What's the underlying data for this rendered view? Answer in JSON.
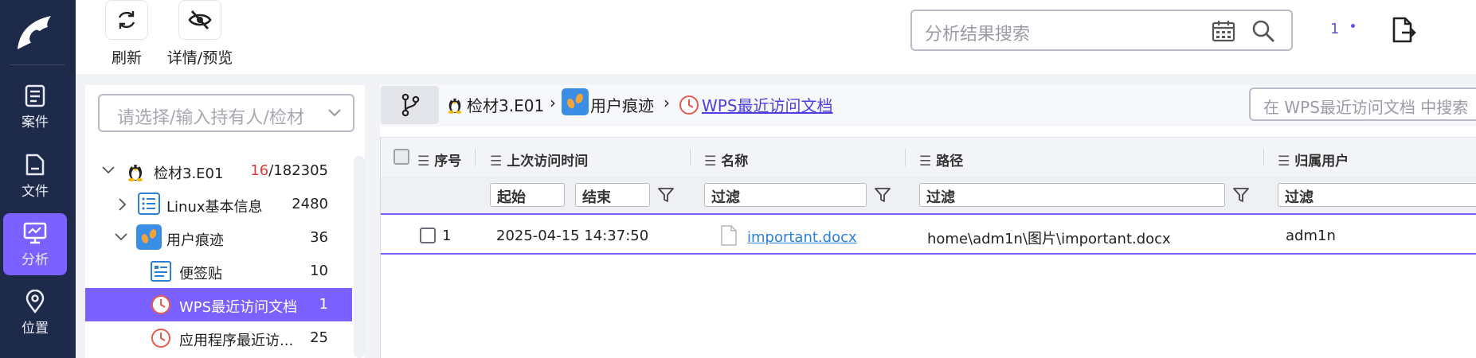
{
  "sidebar": {
    "items": [
      {
        "label": "案件",
        "icon": "clipboard-icon",
        "active": false
      },
      {
        "label": "文件",
        "icon": "file-icon",
        "active": false
      },
      {
        "label": "分析",
        "icon": "analysis-screen-icon",
        "active": true
      },
      {
        "label": "位置",
        "icon": "location-pin-icon",
        "active": false
      }
    ],
    "accent": "#7b61ff",
    "background": "#1e2a4a"
  },
  "toolbar": {
    "refresh_label": "刷新",
    "details_label": "详情/预览"
  },
  "top_search": {
    "placeholder": "分析结果搜索"
  },
  "notifications": {
    "count": "1"
  },
  "tree": {
    "holder_placeholder": "请选择/输入持有人/检材",
    "nodes": [
      {
        "label": "检材3.E01",
        "count_highlight": "16",
        "count_rest": "/182305",
        "icon": "linux-penguin-icon",
        "expanded": true
      },
      {
        "label": "Linux基本信息",
        "count": "2480",
        "icon": "list-icon",
        "expanded": false
      },
      {
        "label": "用户痕迹",
        "count": "36",
        "icon": "footprints-icon",
        "expanded": true
      },
      {
        "label": "便签贴",
        "count": "10",
        "icon": "sticky-note-icon"
      },
      {
        "label": "WPS最近访问文档",
        "count": "1",
        "icon": "recent-clock-icon",
        "selected": true
      },
      {
        "label": "应用程序最近访...",
        "count": "25",
        "icon": "recent-clock-icon"
      }
    ]
  },
  "breadcrumb": {
    "items": [
      "检材3.E01",
      "用户痕迹",
      "WPS最近访问文档"
    ],
    "search_placeholder": "在 WPS最近访问文档 中搜索"
  },
  "table": {
    "columns": [
      "序号",
      "上次访问时间",
      "名称",
      "路径",
      "归属用户"
    ],
    "filters": {
      "start": "起始",
      "end": "结束",
      "name": "过滤",
      "path": "过滤",
      "user": "过滤"
    },
    "rows": [
      {
        "index": "1",
        "time": "2025-04-15 14:37:50",
        "name": "important.docx",
        "path": "home\\adm1n\\图片\\important.docx",
        "user": "adm1n"
      }
    ]
  }
}
